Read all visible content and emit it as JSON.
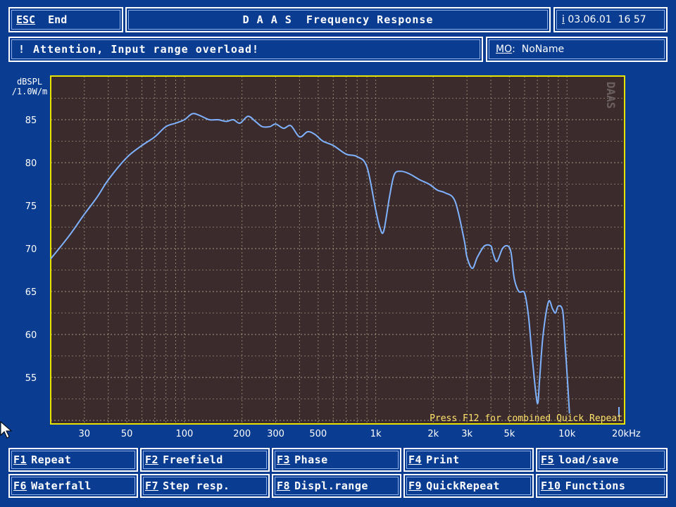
{
  "header": {
    "esc_key": "ESC",
    "esc_label": "End",
    "title": "D A A S  Frequency Response",
    "info_key": "i",
    "datetime": "03.06.01  16 57"
  },
  "alert": {
    "icon": "exclamation-icon",
    "text": "Attention, Input range overload!"
  },
  "mo": {
    "key": "MO",
    "separator": ":",
    "value": "NoName"
  },
  "chart": {
    "watermark": "DAAS",
    "footer_text": "Press F12 for combined Quick Repeat",
    "colors": {
      "background": "#3b2b2c",
      "frame": "#e6e300",
      "grid": "#cfcfa8",
      "curve": "#7fb2ff",
      "footer_text": "#ffe36a",
      "watermark": "#6b6163"
    }
  },
  "chart_data": {
    "type": "line",
    "xscale": "log",
    "ylabel": "dBSPL /1.0W/m",
    "xlabel": "",
    "xlim": [
      20,
      20000
    ],
    "ylim": [
      50,
      88
    ],
    "x_ticks": [
      "30",
      "50",
      "100",
      "200",
      "300",
      "500",
      "1k",
      "2k",
      "3k",
      "5k",
      "10k",
      "20kHz"
    ],
    "y_ticks": [
      "85",
      "80",
      "75",
      "70",
      "65",
      "60",
      "55"
    ],
    "series": [
      {
        "x": [
          20,
          25,
          30,
          35,
          40,
          50,
          60,
          70,
          80,
          90,
          100,
          110,
          120,
          135,
          150,
          165,
          180,
          195,
          215,
          235,
          255,
          280,
          300,
          330,
          360,
          400,
          440,
          480,
          530,
          600,
          700,
          800,
          900,
          1000,
          1050,
          1100,
          1180,
          1250,
          1350,
          1500,
          1700,
          1900,
          2100,
          2300,
          2600,
          2900,
          3000,
          3200,
          3400,
          3700,
          4000,
          4100,
          4300,
          4600,
          4900,
          5100,
          5300,
          5600,
          6000,
          6300,
          6600,
          7000,
          7200,
          7500,
          8000,
          8400,
          8700,
          9000,
          9500,
          9800,
          10100,
          10300
        ],
        "values": [
          68.8,
          71.5,
          74.0,
          76.0,
          78.0,
          80.6,
          82.0,
          83.0,
          84.2,
          84.6,
          85.0,
          85.7,
          85.5,
          85.0,
          85.0,
          84.8,
          85.0,
          84.6,
          85.4,
          84.8,
          84.2,
          84.2,
          84.5,
          84.0,
          84.3,
          83.0,
          83.6,
          83.3,
          82.5,
          82.0,
          81.0,
          80.7,
          79.5,
          74.5,
          72.5,
          72.0,
          76.0,
          78.6,
          79.0,
          78.7,
          78.0,
          77.5,
          76.8,
          76.5,
          75.5,
          71.0,
          69.0,
          67.7,
          69.0,
          70.3,
          70.3,
          69.5,
          68.5,
          70.0,
          70.3,
          69.5,
          66.5,
          65.0,
          64.8,
          62.0,
          57.0,
          52.0,
          55.0,
          60.0,
          63.8,
          63.0,
          62.5,
          63.3,
          62.7,
          58.5,
          54.0,
          50.8
        ]
      }
    ]
  },
  "function_keys": [
    {
      "key": "F1",
      "label": "Repeat"
    },
    {
      "key": "F2",
      "label": "Freefield"
    },
    {
      "key": "F3",
      "label": "Phase"
    },
    {
      "key": "F4",
      "label": "Print"
    },
    {
      "key": "F5",
      "label": "load/save"
    },
    {
      "key": "F6",
      "label": "Waterfall"
    },
    {
      "key": "F7",
      "label": "Step resp."
    },
    {
      "key": "F8",
      "label": "Displ.range"
    },
    {
      "key": "F9",
      "label": "QuickRepeat"
    },
    {
      "key": "F10",
      "label": "Functions"
    }
  ]
}
